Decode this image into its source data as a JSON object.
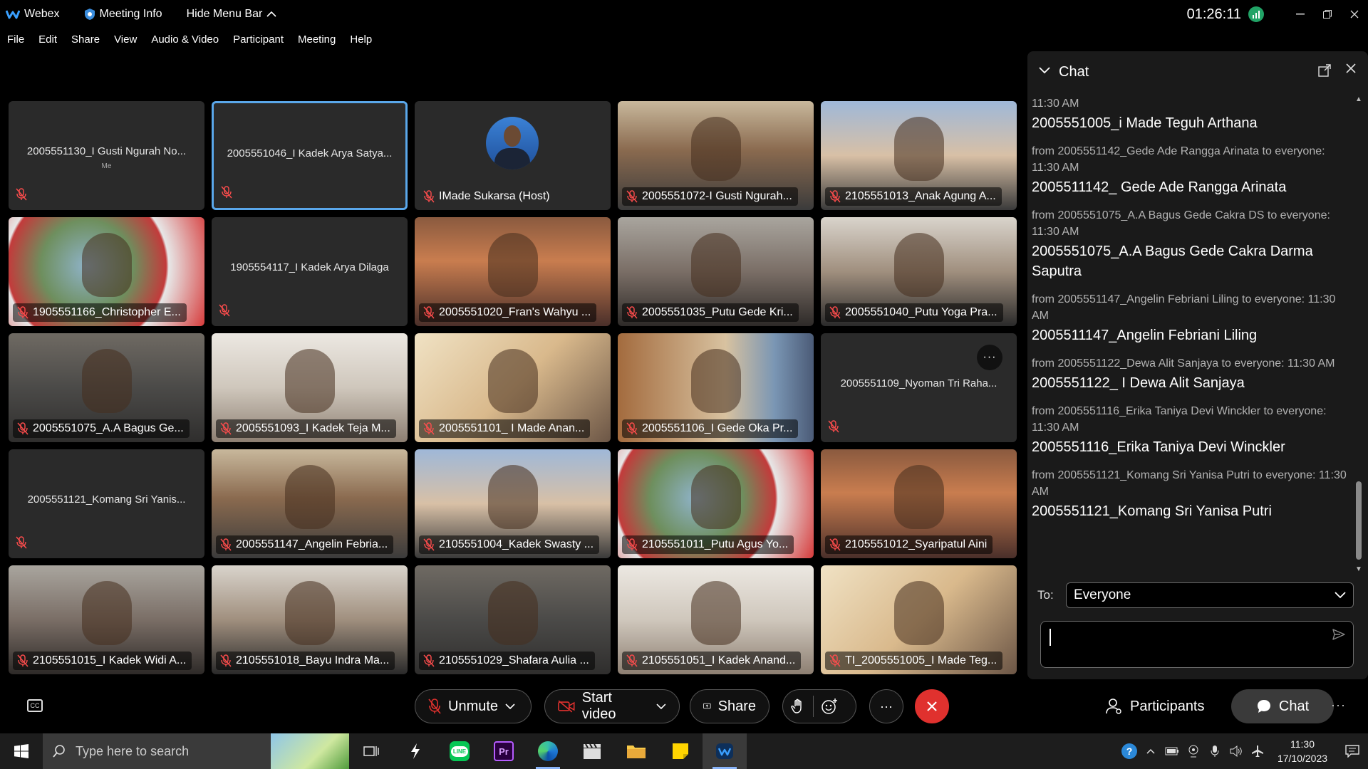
{
  "titlebar": {
    "app_name": "Webex",
    "meeting_info": "Meeting Info",
    "hide_menu": "Hide Menu Bar",
    "clock": "01:26:11",
    "brand_color": "#21a366"
  },
  "menu": [
    "File",
    "Edit",
    "Share",
    "View",
    "Audio & Video",
    "Participant",
    "Meeting",
    "Help"
  ],
  "tiles": [
    {
      "name": "2005551130_I Gusti Ngurah No...",
      "sub": "Me",
      "video": false
    },
    {
      "name": "2005551046_I Kadek Arya Satya...",
      "video": false,
      "active": true
    },
    {
      "name": "IMade Sukarsa (Host)",
      "video": false,
      "avatar": true
    },
    {
      "name": "2005551072-I Gusti Ngurah...",
      "video": true
    },
    {
      "name": "2105551013_Anak Agung A...",
      "video": true
    },
    {
      "name": "1905551166_Christopher E...",
      "video": true
    },
    {
      "name": "1905554117_I Kadek Arya Dilaga",
      "video": false
    },
    {
      "name": "2005551020_Fran's Wahyu ...",
      "video": true
    },
    {
      "name": "2005551035_Putu Gede Kri...",
      "video": true
    },
    {
      "name": "2005551040_Putu Yoga Pra...",
      "video": true
    },
    {
      "name": "2005551075_A.A Bagus Ge...",
      "video": true
    },
    {
      "name": "2005551093_I Kadek Teja M...",
      "video": true
    },
    {
      "name": "2005551101_ I Made Anan...",
      "video": true
    },
    {
      "name": "2005551106_I Gede Oka Pr...",
      "video": true
    },
    {
      "name": "2005551109_Nyoman Tri Raha...",
      "video": false,
      "dots": true
    },
    {
      "name": "2005551121_Komang Sri Yanis...",
      "video": false
    },
    {
      "name": "2005551147_Angelin Febria...",
      "video": true
    },
    {
      "name": "2105551004_Kadek Swasty ...",
      "video": true
    },
    {
      "name": "2105551011_Putu Agus Yo...",
      "video": true
    },
    {
      "name": "2105551012_Syaripatul Aini",
      "video": true
    },
    {
      "name": "2105551015_I Kadek Widi A...",
      "video": true
    },
    {
      "name": "2105551018_Bayu Indra Ma...",
      "video": true
    },
    {
      "name": "2105551029_Shafara Aulia ...",
      "video": true
    },
    {
      "name": "2105551051_I Kadek Anand...",
      "video": true
    },
    {
      "name": "TI_2005551005_I Made Teg...",
      "video": true
    }
  ],
  "chat": {
    "title": "Chat",
    "messages": [
      {
        "meta": "11:30 AM",
        "text": "2005551005_i Made Teguh Arthana"
      },
      {
        "meta": "from 2005551142_Gede Ade Rangga Arinata to everyone: 11:30 AM",
        "text": "2005511142_ Gede Ade Rangga Arinata"
      },
      {
        "meta": "from 2005551075_A.A Bagus Gede Cakra DS to everyone: 11:30 AM",
        "text": "2005551075_A.A Bagus Gede Cakra Darma Saputra"
      },
      {
        "meta": "from 2005551147_Angelin Febriani Liling to everyone: 11:30 AM",
        "text": "2005511147_Angelin Febriani Liling"
      },
      {
        "meta": "from 2005551122_Dewa Alit Sanjaya to everyone:     11:30 AM",
        "text": "2005551122_ I Dewa Alit Sanjaya"
      },
      {
        "meta": "from 2005551116_Erika Taniya Devi Winckler to everyone: 11:30 AM",
        "text": "2005551116_Erika Taniya Devi Winckler"
      },
      {
        "meta": "from 2005551121_Komang Sri Yanisa Putri to everyone: 11:30 AM",
        "text": "2005551121_Komang Sri Yanisa Putri"
      }
    ],
    "to_label": "To:",
    "to_value": "Everyone"
  },
  "controls": {
    "unmute": "Unmute",
    "start_video": "Start video",
    "share": "Share",
    "participants": "Participants",
    "chat": "Chat",
    "end_color": "#e0312e"
  },
  "taskbar": {
    "search_placeholder": "Type here to search",
    "time": "11:30",
    "date": "17/10/2023"
  }
}
